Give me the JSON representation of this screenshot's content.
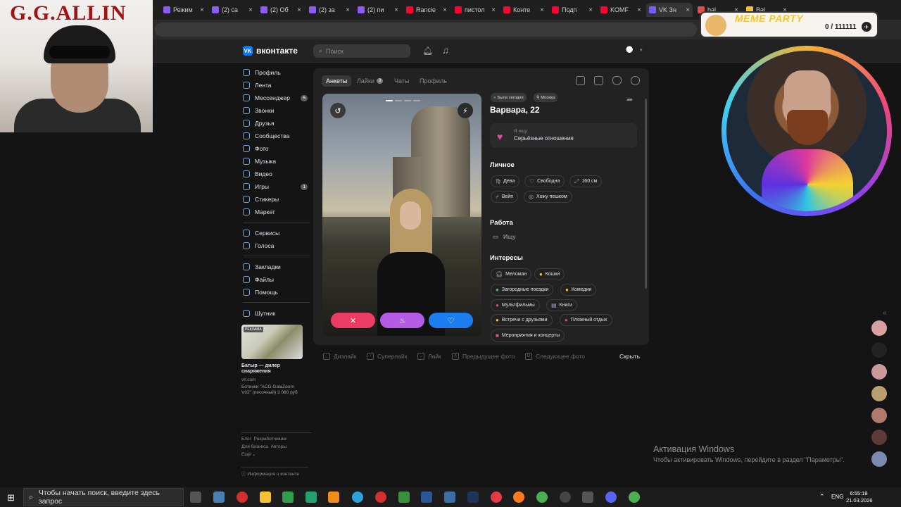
{
  "browser": {
    "tabs": [
      {
        "label": "Режим",
        "color": "#8b5cf6"
      },
      {
        "label": "(2) са",
        "color": "#8b5cf6"
      },
      {
        "label": "(2) Об",
        "color": "#8b5cf6"
      },
      {
        "label": "(2) за",
        "color": "#8b5cf6"
      },
      {
        "label": "(2) пи",
        "color": "#8b5cf6"
      },
      {
        "label": "Rancie",
        "color": "#ff0033"
      },
      {
        "label": "пистол",
        "color": "#ff0033"
      },
      {
        "label": "Конте",
        "color": "#ff0033"
      },
      {
        "label": "Подп",
        "color": "#ff0033"
      },
      {
        "label": "KOMF",
        "color": "#ff0033"
      },
      {
        "label": "VK Зн",
        "color": "#7a5af8"
      },
      {
        "label": "bal...",
        "color": "#e04f4f"
      },
      {
        "label": "Bal...",
        "color": "#f2c231"
      }
    ]
  },
  "vk": {
    "logo": "вконтакте",
    "logo_mark": "VK",
    "search_placeholder": "Поиск",
    "menu": [
      {
        "label": "Профиль"
      },
      {
        "label": "Лента"
      },
      {
        "label": "Мессенджер",
        "count": "5"
      },
      {
        "label": "Звонки"
      },
      {
        "label": "Друзья"
      },
      {
        "label": "Сообщества"
      },
      {
        "label": "Фото"
      },
      {
        "label": "Музыка"
      },
      {
        "label": "Видео"
      },
      {
        "label": "Игры",
        "count": "1"
      },
      {
        "label": "Стикеры"
      },
      {
        "label": "Маркет"
      }
    ],
    "menu2": [
      {
        "label": "Сервисы"
      },
      {
        "label": "Голоса"
      }
    ],
    "menu3": [
      {
        "label": "Закладки"
      },
      {
        "label": "Файлы"
      },
      {
        "label": "Помощь"
      }
    ],
    "menu4": [
      {
        "label": "Шутник"
      }
    ],
    "ad": {
      "tag": "РЕКЛАМА",
      "title": "Батыр — дилер снаряжения",
      "domain": "vk.com",
      "desc": "Ботинки \"ACG GalaZoom V02\" (песочный) 3 080 руб"
    },
    "footer": {
      "l1": "Блог",
      "l2": "Разработчикам",
      "l3": "Для бизнеса",
      "l4": "Авторы",
      "l5": "Ещё ⌄"
    },
    "info": "Информация о контенте"
  },
  "dating": {
    "tabs": [
      "Анкеты",
      "Лайки",
      "Чаты",
      "Профиль"
    ],
    "likes_badge": "3",
    "status_online": "Была сегодня",
    "status_city": "Москва",
    "name": "Варвара, 22",
    "looking_label": "Я ищу",
    "looking_value": "Серьёзные отношения",
    "personal_title": "Личное",
    "personal": [
      "Дева",
      "Свободна",
      "160 см",
      "Вейп",
      "Хожу пешком"
    ],
    "work_title": "Работа",
    "work_value": "Ищу",
    "interests_title": "Интересы",
    "interests": [
      "Меломан",
      "Кошки",
      "Загородные поездки",
      "Комедии",
      "Мультфильмы",
      "Книги",
      "Встречи с друзьями",
      "Пляжный отдых",
      "Мероприятия и концерты"
    ],
    "hints": [
      "Дизлайк",
      "Суперлайк",
      "Лайк",
      "Предыдущее фото",
      "Следующее фото"
    ],
    "hide": "Скрыть",
    "accent_dislike": "#ec3c63",
    "accent_super": "#b45be8",
    "accent_like": "#1a7ef1"
  },
  "overlay": {
    "gg_title": "G.G.ALLIN",
    "meme_title": "MEME PARTY",
    "meme_count": "0 / 111111"
  },
  "windows": {
    "activation_title": "Активация Windows",
    "activation_text": "Чтобы активировать Windows, перейдите в раздел \"Параметры\".",
    "search": "Чтобы начать поиск, введите здесь запрос",
    "lang": "ENG",
    "time": "6:55:18",
    "date": "21.03.2026"
  }
}
